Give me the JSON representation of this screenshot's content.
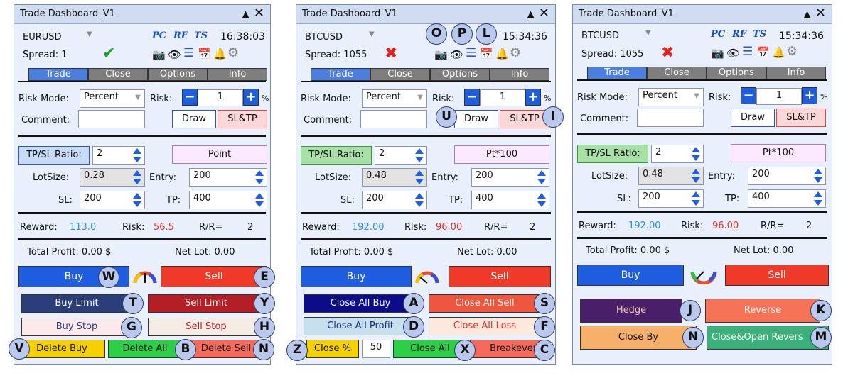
{
  "panels": [
    {
      "title": "Trade Dashboard_V1",
      "symbol": "EURUSD",
      "badges": [
        "PC",
        "RF",
        "TS"
      ],
      "time": "16:38:03",
      "spread": "Spread: 1",
      "spread_status_icon": "check-icon",
      "tabs": [
        "Trade",
        "Close",
        "Options",
        "Info"
      ],
      "risk_mode_label": "Risk Mode:",
      "risk_mode_value": "Percent",
      "risk_label": "Risk:",
      "risk_value": "1",
      "risk_unit": "%",
      "comment_label": "Comment:",
      "draw_label": "Draw",
      "sltp_label": "SL&TP",
      "ratio_label": "TP/SL Ratio:",
      "ratio_value": "2",
      "point_label": "Point",
      "lotsize_label": "LotSize:",
      "lotsize_value": "0.28",
      "entry_label": "Entry:",
      "entry_value": "200",
      "sl_label": "SL:",
      "sl_value": "200",
      "tp_label": "TP:",
      "tp_value": "400",
      "reward_label": "Reward:",
      "reward_value": "113.0",
      "risk2_label": "Risk:",
      "risk2_value": "56.5",
      "rr_label": "R/R=",
      "rr_value": "2",
      "total_profit": "Total Profit:  0.00 $",
      "net_lot": "Net Lot:  0.00",
      "buy_label": "Buy",
      "sell_label": "Sell",
      "row1": [
        "Buy Limit",
        "Sell Limit"
      ],
      "row2": [
        "Buy Stop",
        "Sell Stop"
      ],
      "row3": [
        "Delete Buy",
        "Delete All",
        "Delete Sell"
      ],
      "markers": [
        "W",
        "E",
        "T",
        "Y",
        "G",
        "H",
        "V",
        "B",
        "N"
      ]
    },
    {
      "title": "Trade Dashboard_V1",
      "symbol": "BTCUSD",
      "time": "15:34:36",
      "spread": "Spread: 1055",
      "spread_status_icon": "cross-icon",
      "tabs": [
        "Trade",
        "Close",
        "Options",
        "Info"
      ],
      "risk_mode_label": "Risk Mode:",
      "risk_mode_value": "Percent",
      "risk_label": "Risk:",
      "risk_value": "1",
      "risk_unit": "%",
      "comment_label": "Comment:",
      "draw_label": "Draw",
      "sltp_label": "SL&TP",
      "ratio_label": "TP/SL Ratio:",
      "ratio_value": "2",
      "point_label": "Pt*100",
      "lotsize_label": "LotSize:",
      "lotsize_value": "0.48",
      "entry_label": "Entry:",
      "entry_value": "200",
      "sl_label": "SL:",
      "sl_value": "200",
      "tp_label": "TP:",
      "tp_value": "400",
      "reward_label": "Reward:",
      "reward_value": "192.00",
      "risk2_label": "Risk:",
      "risk2_value": "96.00",
      "rr_label": "R/R=",
      "rr_value": "2",
      "total_profit": "Total Profit:  0.00 $",
      "net_lot": "Net Lot:  0.00",
      "buy_label": "Buy",
      "sell_label": "Sell",
      "row1": [
        "Close All Buy",
        "Close All Sell"
      ],
      "row2": [
        "Close All Profit",
        "Close All Loss"
      ],
      "row3": [
        "Close %",
        "50",
        "Close All",
        "Breakeven"
      ],
      "markers": [
        "O",
        "P",
        "L",
        "U",
        "I",
        "A",
        "S",
        "D",
        "F",
        "Z",
        "X",
        "C"
      ]
    },
    {
      "title": "Trade Dashboard_V1",
      "symbol": "BTCUSD",
      "badges": [
        "PC",
        "RF",
        "TS"
      ],
      "time": "15:34:36",
      "spread": "Spread: 1055",
      "spread_status_icon": "cross-icon",
      "tabs": [
        "Trade",
        "Close",
        "Options",
        "Info"
      ],
      "risk_mode_label": "Risk Mode:",
      "risk_mode_value": "Percent",
      "risk_label": "Risk:",
      "risk_value": "1",
      "risk_unit": "%",
      "comment_label": "Comment:",
      "draw_label": "Draw",
      "sltp_label": "SL&TP",
      "ratio_label": "TP/SL Ratio:",
      "ratio_value": "2",
      "point_label": "Pt*100",
      "lotsize_label": "LotSize:",
      "lotsize_value": "0.48",
      "entry_label": "Entry:",
      "entry_value": "200",
      "sl_label": "SL:",
      "sl_value": "200",
      "tp_label": "TP:",
      "tp_value": "400",
      "reward_label": "Reward:",
      "reward_value": "192.00",
      "risk2_label": "Risk:",
      "risk2_value": "96.00",
      "rr_label": "R/R=",
      "rr_value": "2",
      "total_profit": "Total Profit:  0.00 $",
      "net_lot": "Net Lot:  0.00",
      "buy_label": "Buy",
      "sell_label": "Sell",
      "row1": [
        "Hedge",
        "Reverse"
      ],
      "row2": [
        "Close By",
        "Close&Open Revers"
      ],
      "markers": [
        "J",
        "K",
        "N",
        "M"
      ]
    }
  ],
  "window_controls": {
    "collapse": "▲",
    "close": "✕"
  },
  "icons": [
    "camera-icon",
    "eye-icon",
    "list-icon",
    "calendar-icon",
    "bell-icon",
    "gear-icon",
    "dropdown-arrow-icon",
    "spinner-icon",
    "gauge-icon"
  ],
  "colors": {
    "buy": "#1f5de0",
    "sell": "#ef3a2a",
    "tab_active": "#4a7fe0",
    "tab_inactive": "#7e7e7e",
    "reward": "#2c8fe0",
    "risk": "#e0302a",
    "badge": "#1a49c8"
  }
}
